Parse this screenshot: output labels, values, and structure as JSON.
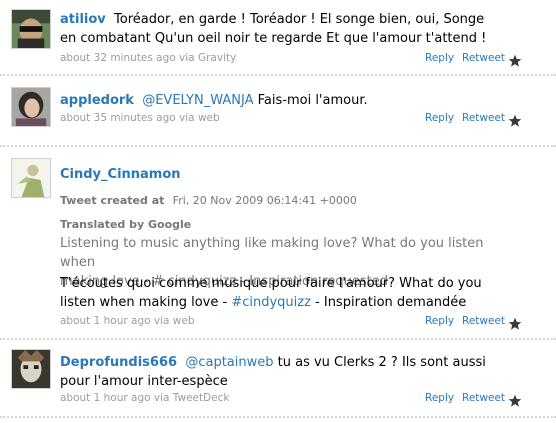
{
  "tweets": [
    {
      "user": "atiliov",
      "text": "Toréador, en garde ! Toréador ! El songe bien, oui, Songe en combatant Qu'un oeil noir te regarde Et que l'amour t'attend !",
      "time": "about 32 minutes ago",
      "via": "via Gravity",
      "reply": "Reply",
      "retweet": "Retweet"
    },
    {
      "user": "appledork",
      "mention": "@EVELYN_WANJA",
      "text": "Fais-moi l'amour.",
      "time": "about 35 minutes ago",
      "via": "via web",
      "reply": "Reply",
      "retweet": "Retweet"
    },
    {
      "user": "Cindy_Cinnamon",
      "created_label": "Tweet created at",
      "created_value": "Fri, 20 Nov 2009 06:14:41 +0000",
      "translated_label": "Translated by Google",
      "translated_text_1": "Listening to music anything like making love? What do you listen when",
      "translated_text_2": "making love - # cindyquizz - Inspiration requested",
      "text_before": "T'écoutes quoi comme musique pour faire l'amour? What do you listen when making love - ",
      "hashtag": "#cindyquizz",
      "text_after": " - Inspiration demandée",
      "time": "about 1 hour ago",
      "via": "via web",
      "reply": "Reply",
      "retweet": "Retweet"
    },
    {
      "user": "Deprofundis666",
      "mention": "@captainweb",
      "text": " tu as vu Clerks 2 ? Ils sont aussi pour l'amour inter-espèce",
      "time": "about 1 hour ago",
      "via": "via TweetDeck",
      "reply": "Reply",
      "retweet": "Retweet"
    }
  ],
  "icons": {
    "favorite": "star-icon"
  },
  "colors": {
    "link": "#2a78b8",
    "meta": "#9c9c9c",
    "separator": "#d6d6d6"
  }
}
